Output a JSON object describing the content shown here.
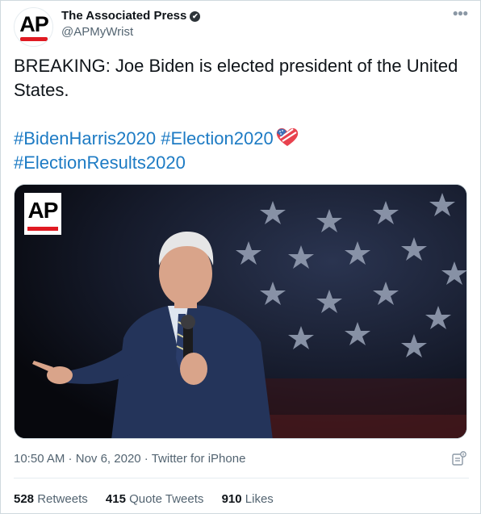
{
  "author": {
    "display_name": "The Associated Press",
    "handle": "@APMyWrist",
    "avatar_text": "AP",
    "verified_glyph": "✔"
  },
  "tweet": {
    "text": "BREAKING:  Joe Biden is elected president of the United States.",
    "hashtags": [
      "#BidenHarris2020",
      "#Election2020",
      "#ElectionResults2020"
    ],
    "hashtag_emoji": "flag-heart-icon",
    "media_watermark": "AP"
  },
  "meta": {
    "time": "10:50 AM",
    "sep1": " · ",
    "date": "Nov 6, 2020",
    "sep2": " · ",
    "client": "Twitter for iPhone"
  },
  "stats": {
    "retweets_count": "528",
    "retweets_label": "Retweets",
    "quotes_count": "415",
    "quotes_label": "Quote Tweets",
    "likes_count": "910",
    "likes_label": "Likes"
  },
  "colors": {
    "link": "#1d7bc4",
    "ap_red": "#e01a22",
    "muted": "#536471"
  }
}
